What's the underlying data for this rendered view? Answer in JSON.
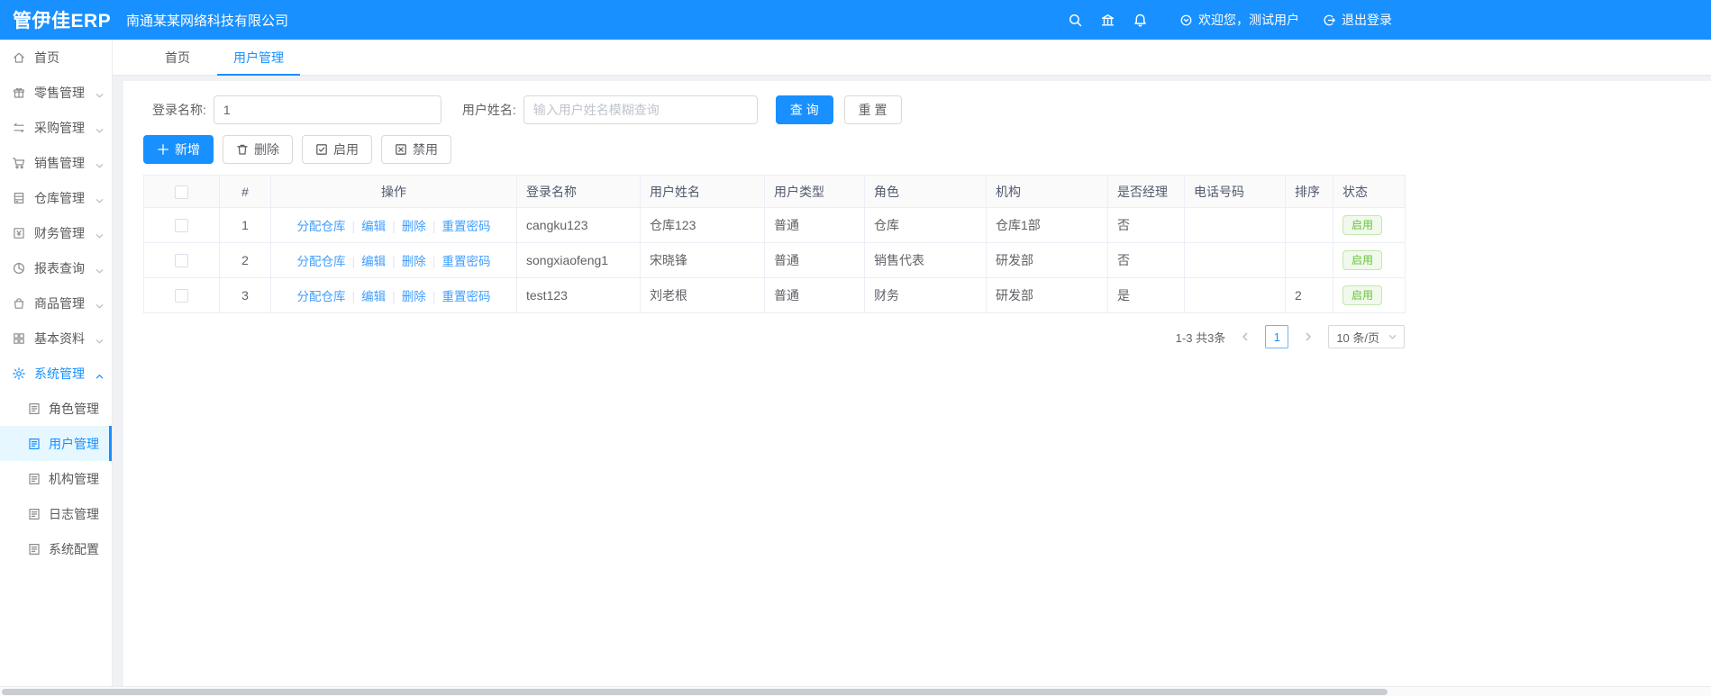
{
  "header": {
    "logo": "管伊佳ERP",
    "company": "南通某某网络科技有限公司",
    "welcome": "欢迎您，测试用户",
    "logout": "退出登录"
  },
  "sidebar": {
    "items": [
      {
        "label": "首页",
        "icon": "home"
      },
      {
        "label": "零售管理",
        "icon": "gift"
      },
      {
        "label": "采购管理",
        "icon": "swap"
      },
      {
        "label": "销售管理",
        "icon": "cart"
      },
      {
        "label": "仓库管理",
        "icon": "warehouse"
      },
      {
        "label": "财务管理",
        "icon": "finance"
      },
      {
        "label": "报表查询",
        "icon": "pie-chart"
      },
      {
        "label": "商品管理",
        "icon": "bag"
      },
      {
        "label": "基本资料",
        "icon": "grid"
      },
      {
        "label": "系统管理",
        "icon": "gear"
      }
    ],
    "sub_items": [
      {
        "label": "角色管理"
      },
      {
        "label": "用户管理"
      },
      {
        "label": "机构管理"
      },
      {
        "label": "日志管理"
      },
      {
        "label": "系统配置"
      }
    ]
  },
  "tabs": [
    {
      "label": "首页"
    },
    {
      "label": "用户管理"
    }
  ],
  "search": {
    "login_label": "登录名称:",
    "login_value": "1",
    "name_label": "用户姓名:",
    "name_placeholder": "输入用户姓名模糊查询",
    "query_label": "查 询",
    "reset_label": "重 置"
  },
  "toolbar": {
    "add": "新增",
    "delete": "删除",
    "enable": "启用",
    "disable": "禁用"
  },
  "table": {
    "columns": [
      "#",
      "操作",
      "登录名称",
      "用户姓名",
      "用户类型",
      "角色",
      "机构",
      "是否经理",
      "电话号码",
      "排序",
      "状态"
    ],
    "op_links": [
      "分配仓库",
      "编辑",
      "删除",
      "重置密码"
    ],
    "rows": [
      {
        "index": "1",
        "login": "cangku123",
        "name": "仓库123",
        "type": "普通",
        "role": "仓库",
        "org": "仓库1部",
        "manager": "否",
        "phone": "",
        "sort": "",
        "status": "启用"
      },
      {
        "index": "2",
        "login": "songxiaofeng1",
        "name": "宋晓锋",
        "type": "普通",
        "role": "销售代表",
        "org": "研发部",
        "manager": "否",
        "phone": "",
        "sort": "",
        "status": "启用"
      },
      {
        "index": "3",
        "login": "test123",
        "name": "刘老根",
        "type": "普通",
        "role": "财务",
        "org": "研发部",
        "manager": "是",
        "phone": "",
        "sort": "2",
        "status": "启用"
      }
    ]
  },
  "pagination": {
    "total": "1-3 共3条",
    "page": "1",
    "page_size": "10 条/页"
  },
  "colors": {
    "accent": "#1890ff",
    "success": "#67c23a",
    "active_bg": "#e6f7ff"
  }
}
